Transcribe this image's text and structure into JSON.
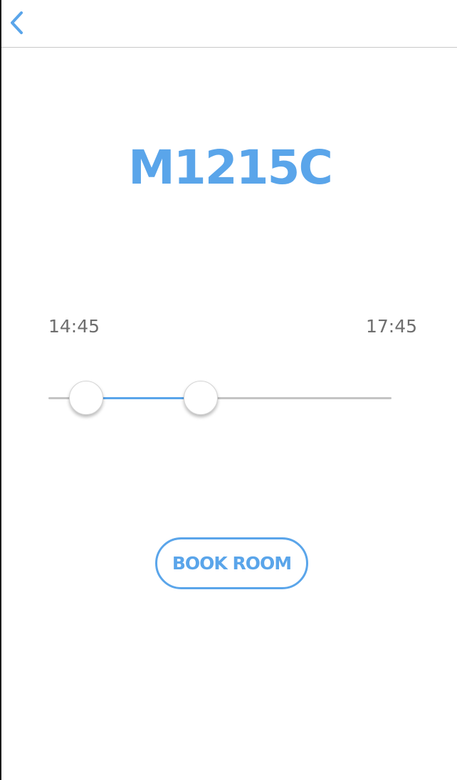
{
  "theme": {
    "accent": "#5aa5ea",
    "track": "#c4c4c4",
    "label": "#6e6e6e"
  },
  "nav": {
    "back_icon": "chevron-left-icon"
  },
  "room": {
    "name": "M1215C"
  },
  "time_slider": {
    "start_label": "14:45",
    "end_label": "17:45",
    "low_fraction": 0.11,
    "high_fraction": 0.445
  },
  "actions": {
    "book_label": "BOOK ROOM"
  }
}
